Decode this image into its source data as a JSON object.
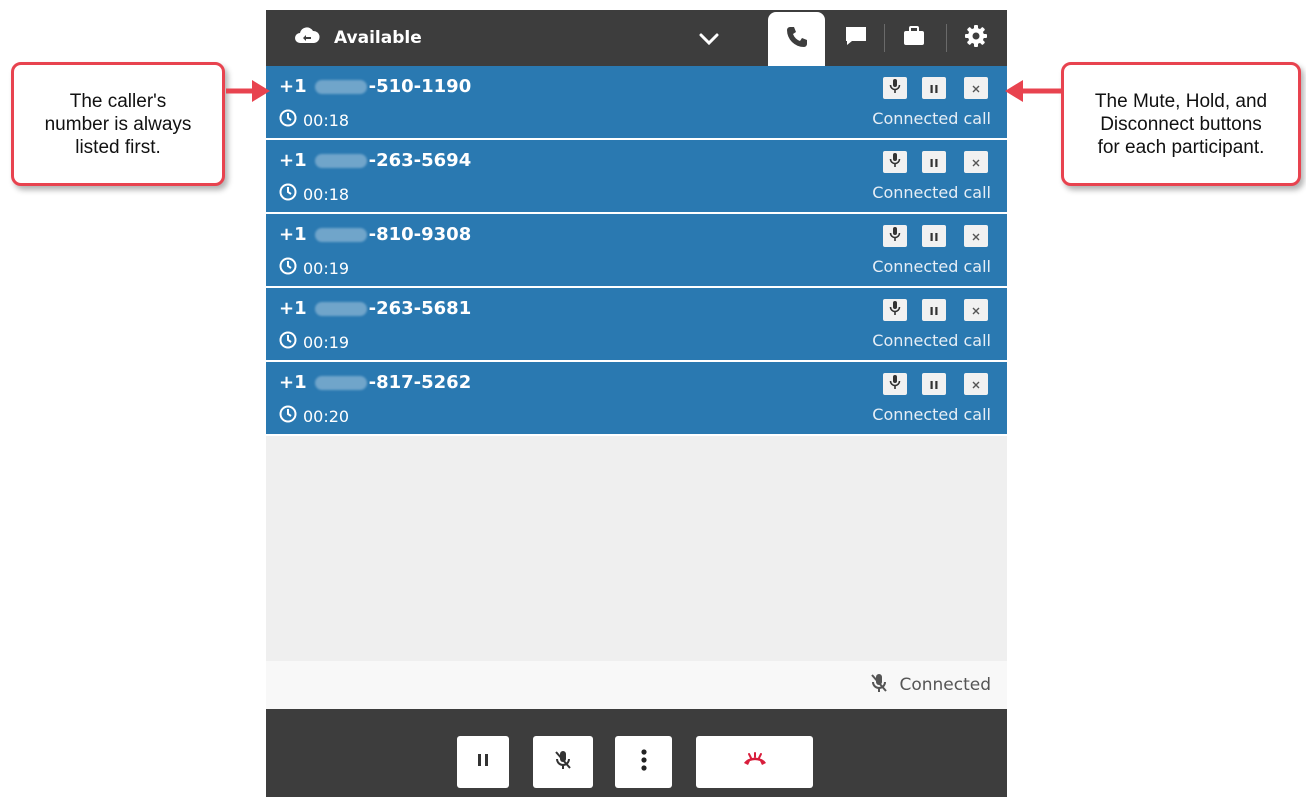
{
  "header": {
    "status_label": "Available",
    "tabs": [
      {
        "name": "phone-icon",
        "active": true
      },
      {
        "name": "chat-icon",
        "active": false
      },
      {
        "name": "briefcase-icon",
        "active": false
      },
      {
        "name": "gear-icon",
        "active": false
      }
    ]
  },
  "calls": [
    {
      "prefix": "+1",
      "suffix": "-510-1190",
      "timer": "00:18",
      "state": "Connected call"
    },
    {
      "prefix": "+1",
      "suffix": "-263-5694",
      "timer": "00:18",
      "state": "Connected call"
    },
    {
      "prefix": "+1",
      "suffix": "-810-9308",
      "timer": "00:19",
      "state": "Connected call"
    },
    {
      "prefix": "+1",
      "suffix": "-263-5681",
      "timer": "00:19",
      "state": "Connected call"
    },
    {
      "prefix": "+1",
      "suffix": "-817-5262",
      "timer": "00:20",
      "state": "Connected call"
    }
  ],
  "connection": {
    "status": "Connected"
  },
  "callouts": {
    "left": [
      "The caller's",
      "number is always",
      "listed first."
    ],
    "right": [
      "The Mute, Hold, and",
      "Disconnect buttons",
      "for each participant."
    ]
  },
  "colors": {
    "header": "#3d3d3d",
    "call_row": "#2a79b1",
    "callout_border": "#e8434f",
    "hangup": "#d81e3c"
  }
}
